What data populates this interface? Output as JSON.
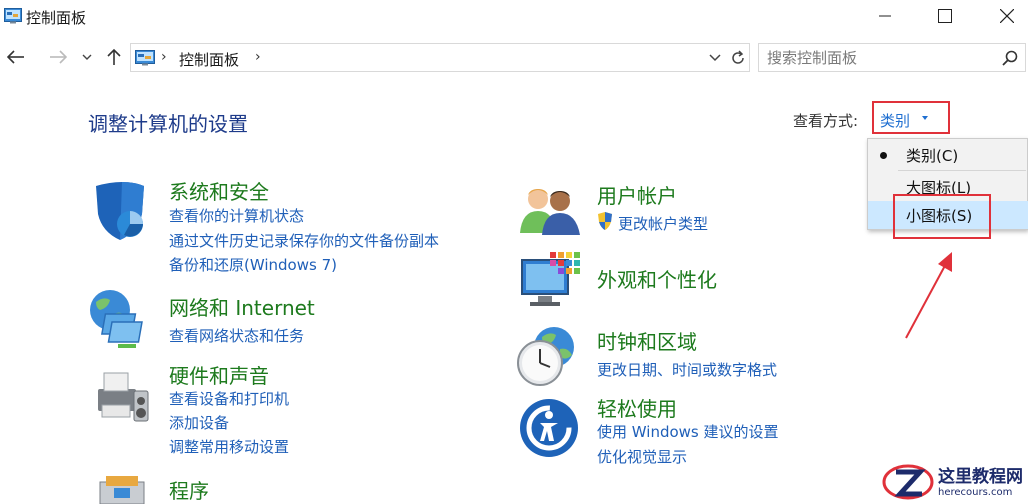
{
  "window": {
    "title": "控制面板"
  },
  "nav": {
    "breadcrumb": "控制面板"
  },
  "search": {
    "placeholder": "搜索控制面板"
  },
  "page": {
    "title": "调整计算机的设置"
  },
  "view_by": {
    "label": "查看方式:",
    "selected": "类别",
    "options": [
      "类别(C)",
      "大图标(L)",
      "小图标(S)"
    ],
    "checked_option": "类别(C)",
    "hovered_option": "小图标(S)"
  },
  "categories": {
    "system": {
      "title": "系统和安全",
      "links": [
        "查看你的计算机状态",
        "通过文件历史记录保存你的文件备份副本",
        "备份和还原(Windows 7)"
      ]
    },
    "network": {
      "title": "网络和 Internet",
      "links": [
        "查看网络状态和任务"
      ]
    },
    "hardware": {
      "title": "硬件和声音",
      "links": [
        "查看设备和打印机",
        "添加设备",
        "调整常用移动设置"
      ]
    },
    "programs": {
      "title": "程序"
    },
    "users": {
      "title": "用户帐户",
      "links": [
        "更改帐户类型"
      ]
    },
    "appearance": {
      "title": "外观和个性化"
    },
    "clock": {
      "title": "时钟和区域",
      "links": [
        "更改日期、时间或数字格式"
      ]
    },
    "ease": {
      "title": "轻松使用",
      "links": [
        "使用 Windows 建议的设置",
        "优化视觉显示"
      ]
    }
  },
  "watermark": {
    "name": "这里教程网",
    "url": "herecours.com"
  },
  "colors": {
    "category_title": "#1d7a1d",
    "link": "#1f5fb8",
    "page_title": "#1e3b8a",
    "annotation_red": "#e0313a",
    "menu_hover": "#cce8ff"
  }
}
